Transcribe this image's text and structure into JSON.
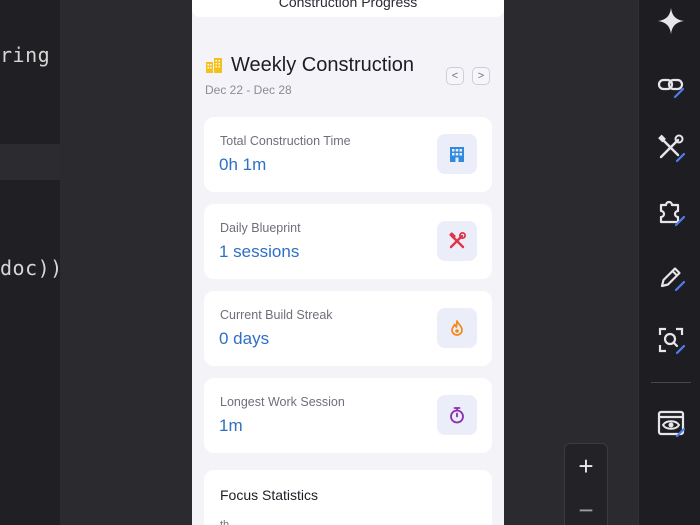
{
  "editor": {
    "line1": "ring u",
    "line2": "doc))"
  },
  "phone": {
    "topbar_title": "Construction Progress",
    "week": {
      "title": "Weekly Construction",
      "range": "Dec 22 - Dec 28",
      "prev_label": "<",
      "next_label": ">"
    },
    "stats": [
      {
        "label": "Total Construction Time",
        "value": "0h 1m",
        "icon": "building-icon",
        "icon_color": "#2f8be0"
      },
      {
        "label": "Daily Blueprint",
        "value": "1 sessions",
        "icon": "hammer-wrench-icon",
        "icon_color": "#e0344a"
      },
      {
        "label": "Current Build Streak",
        "value": "0 days",
        "icon": "flame-icon",
        "icon_color": "#f08a1c"
      },
      {
        "label": "Longest Work Session",
        "value": "1m",
        "icon": "stopwatch-icon",
        "icon_color": "#8b2fb0"
      }
    ],
    "focus": {
      "title": "Focus Statistics",
      "subtitle": "th"
    }
  },
  "zoom": {
    "plus": "+",
    "minus": "−"
  },
  "rail": {
    "items": [
      "sparkle-icon",
      "link-edit-icon",
      "tools-edit-icon",
      "puzzle-edit-icon",
      "pencil-edit-icon",
      "inspect-edit-icon",
      "preview-eye-icon"
    ],
    "accent": "#4f7df0"
  }
}
